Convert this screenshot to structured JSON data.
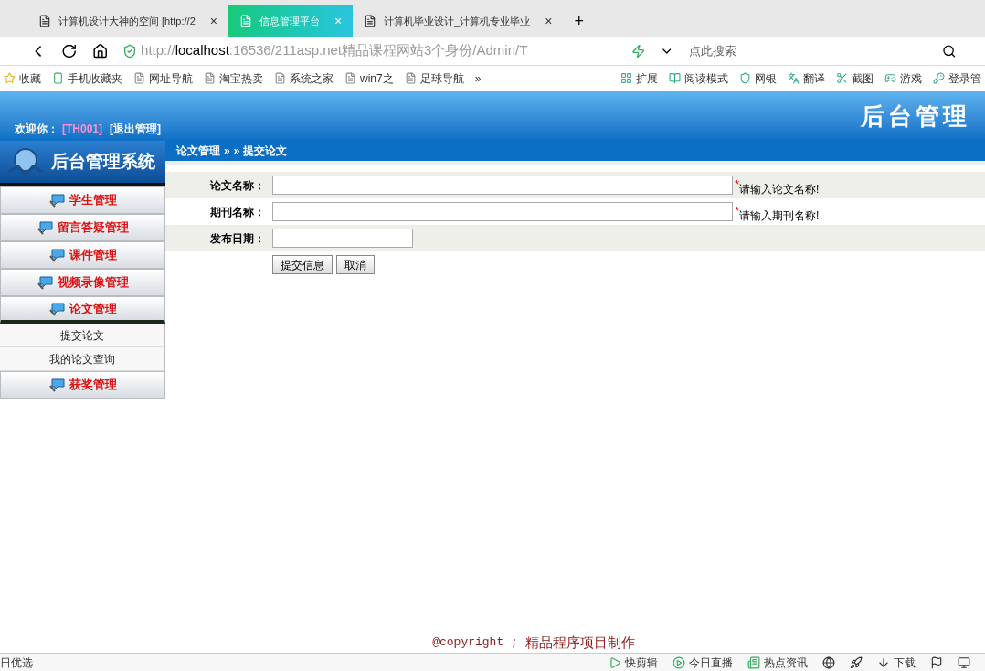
{
  "browser": {
    "tabs": [
      {
        "title": "计算机设计大神的空间 [http://2",
        "selected": false,
        "close": "×"
      },
      {
        "title": "信息管理平台",
        "selected": true,
        "close": "×"
      },
      {
        "title": "计算机毕业设计_计算机专业毕业",
        "selected": false,
        "close": "×"
      }
    ],
    "new_tab": "+",
    "address": {
      "scheme": "http://",
      "host": "localhost",
      "rest": ":16536/211asp.net精品课程网站3个身份/Admin/T"
    },
    "search": {
      "placeholder": "点此搜索"
    },
    "bookmarks": [
      "收藏",
      "手机收藏夹",
      "网址导航",
      "淘宝热卖",
      "系统之家",
      "win7之",
      "足球导航"
    ],
    "more_bookmarks": "»",
    "tools": [
      "扩展",
      "阅读模式",
      "网银",
      "翻译",
      "截图",
      "游戏",
      "登录管"
    ]
  },
  "header": {
    "welcome": "欢迎你：",
    "user": "[TH001]",
    "logout": "[退出管理]",
    "logo": "后台管理"
  },
  "sidebar": {
    "title": "后台管理系统",
    "items": [
      {
        "label": "学生管理",
        "expanded": false
      },
      {
        "label": "留言答疑管理",
        "expanded": false
      },
      {
        "label": "课件管理",
        "expanded": false
      },
      {
        "label": "视频录像管理",
        "expanded": false
      },
      {
        "label": "论文管理",
        "expanded": true,
        "children": [
          {
            "label": "提交论文"
          },
          {
            "label": "我的论文查询"
          }
        ]
      },
      {
        "label": "获奖管理",
        "expanded": false
      }
    ]
  },
  "breadcrumb": [
    "论文管理",
    "»",
    "»",
    "提交论文"
  ],
  "form": {
    "fields": [
      {
        "label": "论文名称：",
        "kind": "long",
        "required": true,
        "mark": "*",
        "hint": "请输入论文名称!"
      },
      {
        "label": "期刊名称：",
        "kind": "long",
        "required": true,
        "mark": "*",
        "hint": "请输入期刊名称!"
      },
      {
        "label": "发布日期：",
        "kind": "short",
        "required": false
      }
    ],
    "buttons": [
      "提交信息",
      "取消"
    ]
  },
  "footer": {
    "copyright": "@copyright ;",
    "text": "精品程序项目制作"
  },
  "status_bar": {
    "left": "日优选",
    "items": [
      "快剪辑",
      "今日直播",
      "热点资讯"
    ],
    "download": "下载"
  }
}
